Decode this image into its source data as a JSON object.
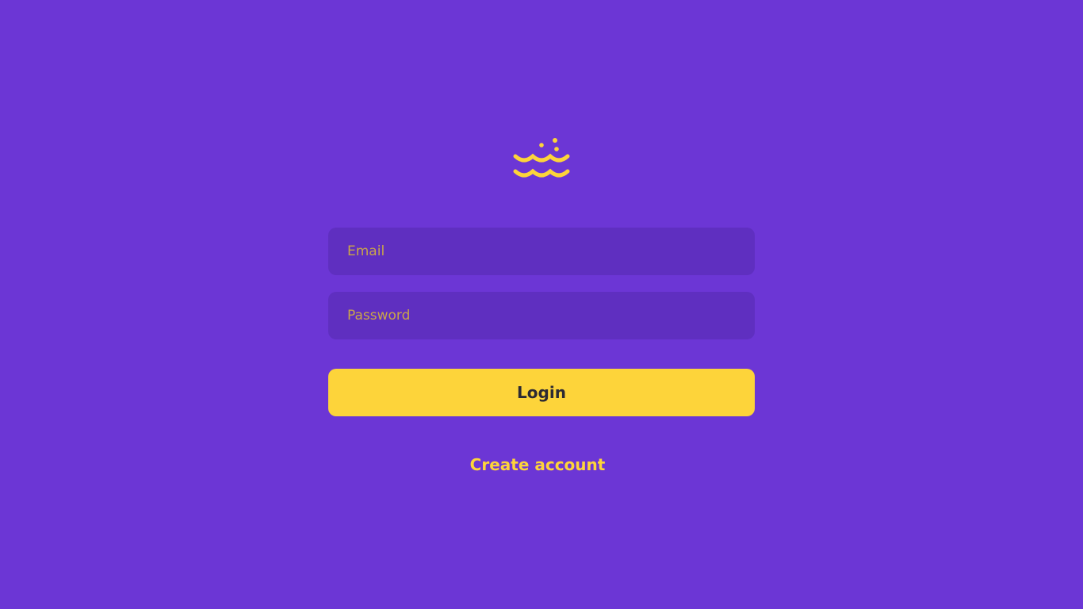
{
  "theme": {
    "background": "#6C36D5",
    "field_background": "#5F2FC0",
    "accent": "#FDD43A",
    "button_text": "#2C2A33"
  },
  "logo": {
    "icon": "waves-with-bubbles-icon"
  },
  "form": {
    "email_placeholder": "Email",
    "password_placeholder": "Password",
    "login_label": "Login",
    "create_account_label": "Create account"
  }
}
